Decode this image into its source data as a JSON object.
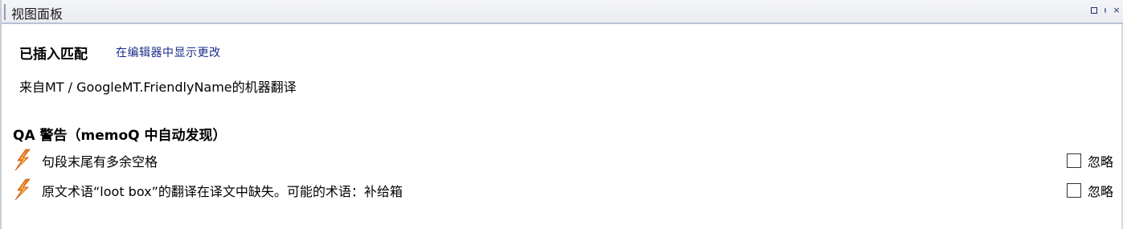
{
  "panel": {
    "title": "视图面板",
    "buttons": [
      "▫",
      "ᵼ",
      "×"
    ]
  },
  "match": {
    "title": "已插入匹配",
    "show_changes_link": "在编辑器中显示更改",
    "source": "来自MT / GoogleMT.FriendlyName的机器翻译"
  },
  "qa": {
    "title": "QA 警告（memoQ 中自动发现）",
    "warnings": [
      {
        "text": "句段末尾有多余空格",
        "ignore_label": "忽略",
        "icon": "lightning-warning-icon"
      },
      {
        "text": "原文术语“loot box”的翻译在译文中缺失。可能的术语：补给箱",
        "ignore_label": "忽略",
        "icon": "lightning-warning-icon"
      }
    ]
  },
  "colors": {
    "link": "#1a2c8a",
    "warning_icon": "#f07a1a"
  }
}
